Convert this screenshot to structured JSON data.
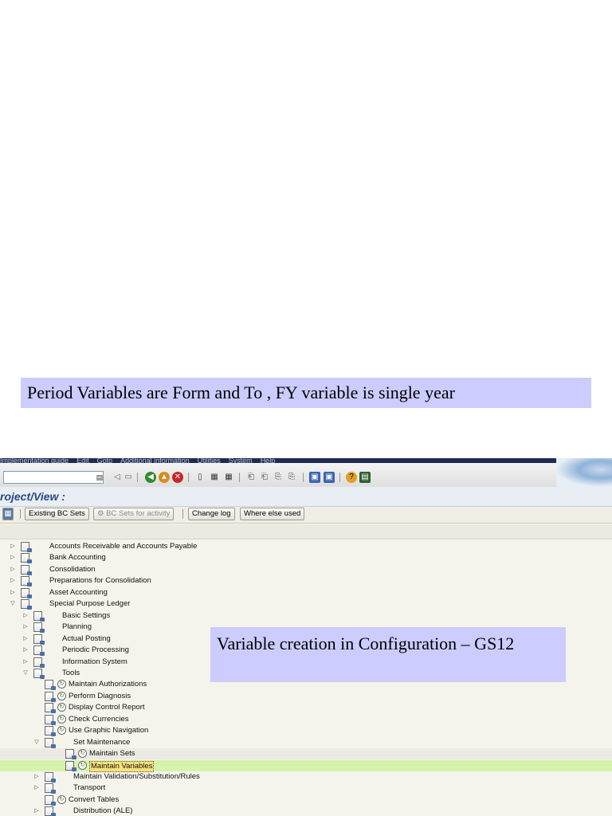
{
  "captions": {
    "top": "Period Variables are Form and To , FY variable is single year",
    "bottom": "Variable creation in Configuration – GS12"
  },
  "menu": [
    "Implementation guide",
    "Edit",
    "Goto",
    "Additional information",
    "Utilities",
    "System",
    "Help"
  ],
  "title": "roject/View :",
  "app_toolbar": {
    "existing_bc_sets": "Existing BC Sets",
    "bc_sets_for_activity": "BC Sets for activity",
    "change_log": "Change log",
    "where_else_used": "Where else used"
  },
  "tree": [
    {
      "label": "Accounts Receivable and Accounts Payable",
      "level": 0,
      "expander": "closed",
      "exec": false
    },
    {
      "label": "Bank Accounting",
      "level": 0,
      "expander": "closed",
      "exec": false
    },
    {
      "label": "Consolidation",
      "level": 0,
      "expander": "closed",
      "exec": false
    },
    {
      "label": "Preparations for Consolidation",
      "level": 0,
      "expander": "closed",
      "exec": false
    },
    {
      "label": "Asset Accounting",
      "level": 0,
      "expander": "closed",
      "exec": false
    },
    {
      "label": "Special Purpose Ledger",
      "level": 0,
      "expander": "open",
      "exec": false
    },
    {
      "label": "Basic Settings",
      "level": 1,
      "expander": "closed",
      "exec": false
    },
    {
      "label": "Planning",
      "level": 1,
      "expander": "closed",
      "exec": false
    },
    {
      "label": "Actual Posting",
      "level": 1,
      "expander": "closed",
      "exec": false
    },
    {
      "label": "Periodic Processing",
      "level": 1,
      "expander": "closed",
      "exec": false
    },
    {
      "label": "Information System",
      "level": 1,
      "expander": "closed",
      "exec": false
    },
    {
      "label": "Tools",
      "level": 1,
      "expander": "open",
      "exec": false
    },
    {
      "label": "Maintain Authorizations",
      "level": 2,
      "expander": "none",
      "exec": true
    },
    {
      "label": "Perform Diagnosis",
      "level": 2,
      "expander": "none",
      "exec": true
    },
    {
      "label": "Display Control Report",
      "level": 2,
      "expander": "none",
      "exec": true
    },
    {
      "label": "Check Currencies",
      "level": 2,
      "expander": "none",
      "exec": true
    },
    {
      "label": "Use Graphic Navigation",
      "level": 2,
      "expander": "none",
      "exec": true
    },
    {
      "label": "Set Maintenance",
      "level": 2,
      "expander": "open",
      "exec": false
    },
    {
      "label": "Maintain Sets",
      "level": 3,
      "expander": "none",
      "exec": true,
      "state": "hover"
    },
    {
      "label": "Maintain Variables",
      "level": 3,
      "expander": "none",
      "exec": true,
      "state": "selected"
    },
    {
      "label": "Maintain Validation/Substitution/Rules",
      "level": 2,
      "expander": "closed",
      "exec": false
    },
    {
      "label": "Transport",
      "level": 2,
      "expander": "closed",
      "exec": false
    },
    {
      "label": "Convert Tables",
      "level": 2,
      "expander": "none",
      "exec": true
    },
    {
      "label": "Distribution (ALE)",
      "level": 2,
      "expander": "closed",
      "exec": false
    }
  ]
}
